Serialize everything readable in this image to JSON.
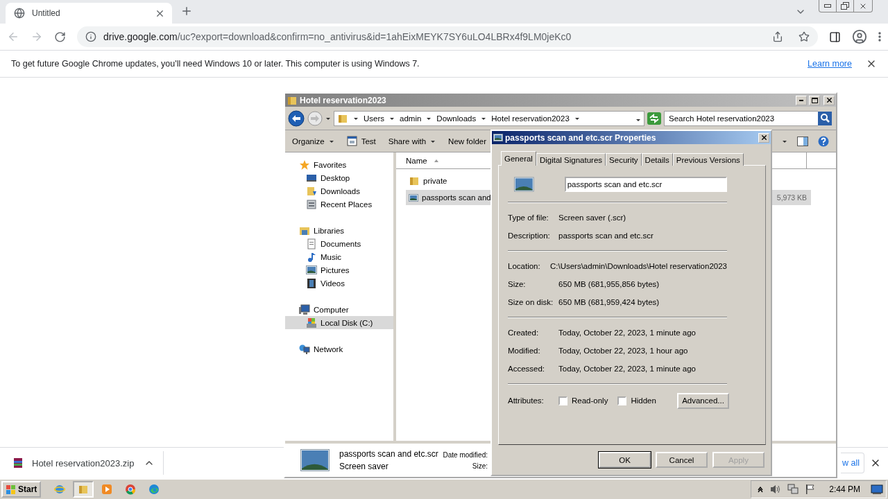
{
  "browser": {
    "tab": {
      "title": "Untitled"
    },
    "address": {
      "host": "drive.google.com",
      "path": "/uc?export=download&confirm=no_antivirus&id=1ahEixMEYK7SY6uLO4LBRx4f9LM0jeKc0"
    },
    "infobar": {
      "message": "To get future Google Chrome updates, you'll need Windows 10 or later. This computer is using Windows 7.",
      "link": "Learn more"
    }
  },
  "download_shelf": {
    "items": [
      {
        "name": "Hotel reservation2023.zip"
      }
    ],
    "show_all": "w all"
  },
  "explorer": {
    "title": "Hotel reservation2023",
    "breadcrumb": [
      "Users",
      "admin",
      "Downloads",
      "Hotel reservation2023"
    ],
    "search": {
      "placeholder": "Search Hotel reservation2023"
    },
    "toolbar": [
      {
        "label": "Organize",
        "menu": true,
        "kind": "plain"
      },
      {
        "label": "Test",
        "menu": false,
        "kind": "app"
      },
      {
        "label": "Share with",
        "menu": true,
        "kind": "plain"
      },
      {
        "label": "New folder",
        "menu": false,
        "kind": "plain"
      }
    ],
    "nav": [
      {
        "label": "Favorites",
        "kind": "star",
        "selected": false,
        "children": [
          {
            "label": "Desktop",
            "kind": "desktop",
            "selected": false
          },
          {
            "label": "Downloads",
            "kind": "downloads",
            "selected": false
          },
          {
            "label": "Recent Places",
            "kind": "recent",
            "selected": false
          }
        ]
      },
      {
        "label": "Libraries",
        "kind": "library",
        "selected": false,
        "children": [
          {
            "label": "Documents",
            "kind": "document",
            "selected": false
          },
          {
            "label": "Music",
            "kind": "music",
            "selected": false
          },
          {
            "label": "Pictures",
            "kind": "picture",
            "selected": false
          },
          {
            "label": "Videos",
            "kind": "video",
            "selected": false
          }
        ]
      },
      {
        "label": "Computer",
        "kind": "computer",
        "selected": false,
        "children": [
          {
            "label": "Local Disk (C:)",
            "kind": "disk",
            "selected": true
          }
        ]
      },
      {
        "label": "Network",
        "kind": "network",
        "selected": false
      }
    ],
    "columns": [
      {
        "label": "Name"
      }
    ],
    "files": [
      {
        "name": "private",
        "kind": "folder",
        "selected": false
      },
      {
        "name": "passports scan and",
        "kind": "screensaver",
        "selected": true,
        "size": "5,973 KB"
      }
    ],
    "details": {
      "name": "passports scan and etc.scr",
      "type": "Screen saver",
      "labels": [
        "Date modified:",
        "Size:"
      ]
    }
  },
  "dialog": {
    "title": "passports scan and etc.scr Properties",
    "tabs": [
      {
        "label": "General",
        "selected": true
      },
      {
        "label": "Digital Signatures",
        "selected": false
      },
      {
        "label": "Security",
        "selected": false
      },
      {
        "label": "Details",
        "selected": false
      },
      {
        "label": "Previous Versions",
        "selected": false
      }
    ],
    "filename": "passports scan and etc.scr",
    "groups": [
      [
        {
          "label": "Type of file:",
          "value": "Screen saver (.scr)"
        },
        {
          "label": "Description:",
          "value": "passports scan and etc.scr"
        }
      ],
      [
        {
          "label": "Location:",
          "value": "C:\\Users\\admin\\Downloads\\Hotel reservation2023"
        },
        {
          "label": "Size:",
          "value": "650 MB (681,955,856 bytes)"
        },
        {
          "label": "Size on disk:",
          "value": "650 MB (681,959,424 bytes)"
        }
      ],
      [
        {
          "label": "Created:",
          "value": "Today, October 22, 2023, 1 minute ago"
        },
        {
          "label": "Modified:",
          "value": "Today, October 22, 2023, 1 hour ago"
        },
        {
          "label": "Accessed:",
          "value": "Today, October 22, 2023, 1 minute ago"
        }
      ]
    ],
    "attributes_label": "Attributes:",
    "attributes": [
      {
        "label": "Read-only",
        "checked": false
      },
      {
        "label": "Hidden",
        "checked": false
      }
    ],
    "advanced": "Advanced...",
    "buttons": [
      {
        "label": "OK",
        "disabled": false
      },
      {
        "label": "Cancel",
        "disabled": false
      },
      {
        "label": "Apply",
        "disabled": true
      }
    ]
  },
  "taskbar": {
    "start": "Start",
    "apps": [
      {
        "kind": "ie",
        "selected": false
      },
      {
        "kind": "folder",
        "selected": true
      },
      {
        "kind": "media",
        "selected": false
      },
      {
        "kind": "chrome",
        "selected": false
      },
      {
        "kind": "edge",
        "selected": false
      }
    ],
    "clock": "2:44 PM"
  }
}
